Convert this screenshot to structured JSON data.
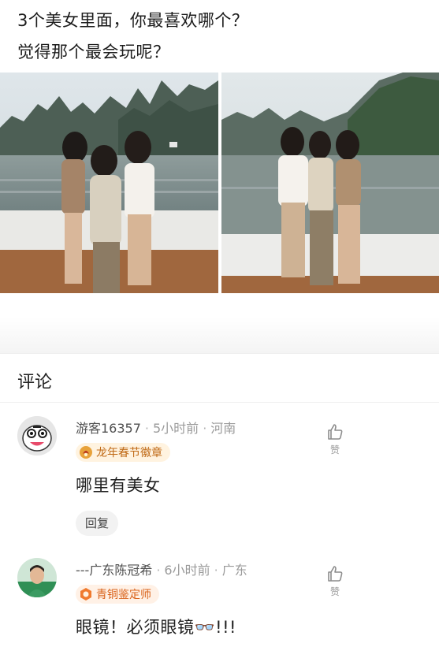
{
  "post": {
    "line1": "3个美女里面，你最喜欢哪个？",
    "line2": "觉得那个最会玩呢？"
  },
  "comments_section": {
    "title": "评论"
  },
  "comments": [
    {
      "username": "游客16357",
      "time": "5小时前",
      "location": "河南",
      "badge": "龙年春节徽章",
      "text": "哪里有美女",
      "reply_label": "回复",
      "like_label": "赞"
    },
    {
      "username": "---广东陈冠希",
      "time": "6小时前",
      "location": "广东",
      "badge": "青铜鉴定师",
      "text": "眼镜！必须眼镜👓!!!",
      "like_label": "赞"
    }
  ],
  "colors": {
    "badge_text": "#c06a16",
    "meta_text": "#9a9a9a",
    "reply_bg": "#f2f2f2"
  },
  "icons": [
    "thumbs-up-icon",
    "dragon-badge-icon",
    "bronze-badge-icon",
    "reply-button"
  ]
}
